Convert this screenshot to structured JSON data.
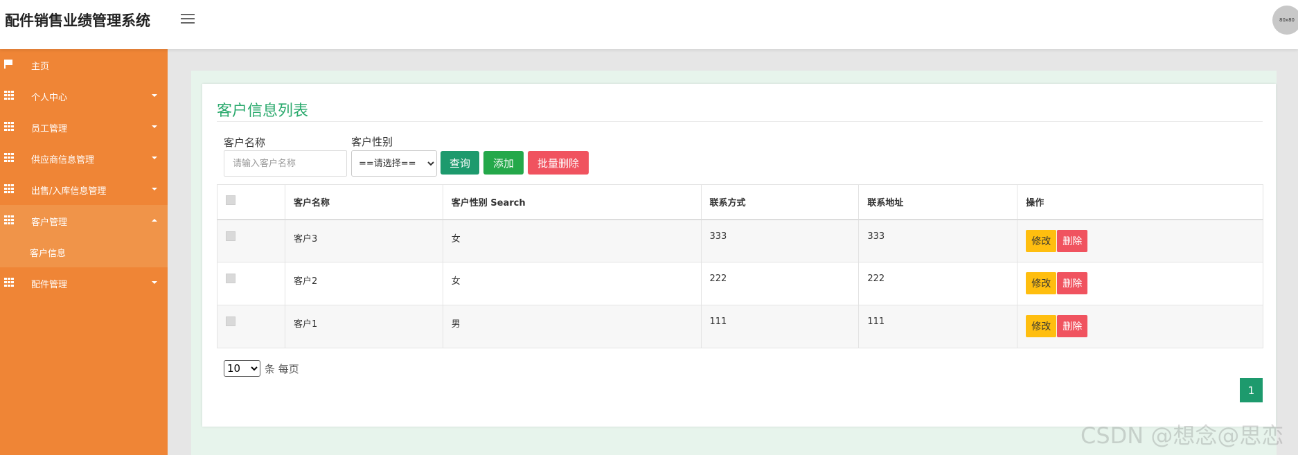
{
  "app": {
    "title": "配件销售业绩管理系统",
    "avatar_text": "80x80"
  },
  "sidebar": {
    "items": [
      {
        "label": "主页",
        "icon": "flag-icon",
        "expandable": false
      },
      {
        "label": "个人中心",
        "icon": "grid-icon",
        "expandable": true
      },
      {
        "label": "员工管理",
        "icon": "grid-icon",
        "expandable": true
      },
      {
        "label": "供应商信息管理",
        "icon": "grid-icon",
        "expandable": true
      },
      {
        "label": "出售/入库信息管理",
        "icon": "grid-icon",
        "expandable": true
      },
      {
        "label": "客户管理",
        "icon": "grid-icon",
        "expandable": true,
        "expanded": true,
        "children": [
          "客户信息"
        ]
      },
      {
        "label": "配件管理",
        "icon": "grid-icon",
        "expandable": true
      }
    ]
  },
  "main": {
    "title": "客户信息列表",
    "filters": {
      "name_label": "客户名称",
      "name_placeholder": "请输入客户名称",
      "gender_label": "客户性别",
      "gender_selected": "==请选择=="
    },
    "buttons": {
      "query": "查询",
      "add": "添加",
      "batch_delete": "批量删除"
    },
    "table": {
      "headers": [
        "",
        "客户名称",
        "客户性别 Search",
        "联系方式",
        "联系地址",
        "操作"
      ],
      "rows": [
        {
          "name": "客户3",
          "gender": "女",
          "phone": "333",
          "address": "333"
        },
        {
          "name": "客户2",
          "gender": "女",
          "phone": "222",
          "address": "222"
        },
        {
          "name": "客户1",
          "gender": "男",
          "phone": "111",
          "address": "111"
        }
      ],
      "edit_label": "修改",
      "delete_label": "删除"
    },
    "pagination": {
      "page_size": "10",
      "page_size_suffix": "条 每页",
      "current_page": "1"
    }
  },
  "watermark": "CSDN @想念@思恋",
  "colors": {
    "sidebar": "#ef8536",
    "accent_green": "#29a96c",
    "query": "#1d9a6d",
    "add": "#24a84a",
    "danger": "#f0535f",
    "edit": "#ffbe0f"
  }
}
